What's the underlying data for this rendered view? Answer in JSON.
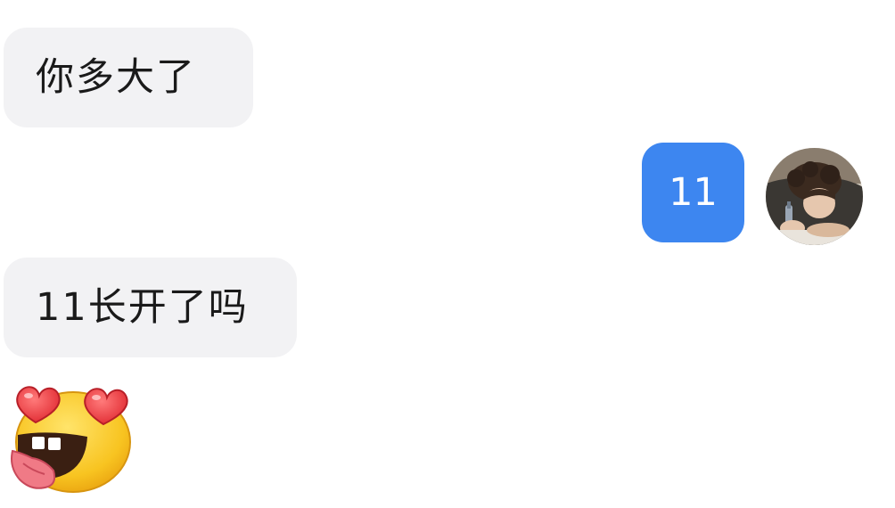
{
  "messages": [
    {
      "direction": "incoming",
      "text": "你多大了"
    },
    {
      "direction": "outgoing",
      "text": "11"
    },
    {
      "direction": "incoming",
      "text": "11长开了吗"
    }
  ],
  "sticker": {
    "icon": "heart-eyes-tongue-emoji-icon"
  },
  "avatar": {
    "icon": "user-avatar-icon"
  },
  "colors": {
    "incoming_bubble": "#f2f2f4",
    "outgoing_bubble": "#3d86f0",
    "incoming_text": "#1a1a1a",
    "outgoing_text": "#ffffff"
  }
}
